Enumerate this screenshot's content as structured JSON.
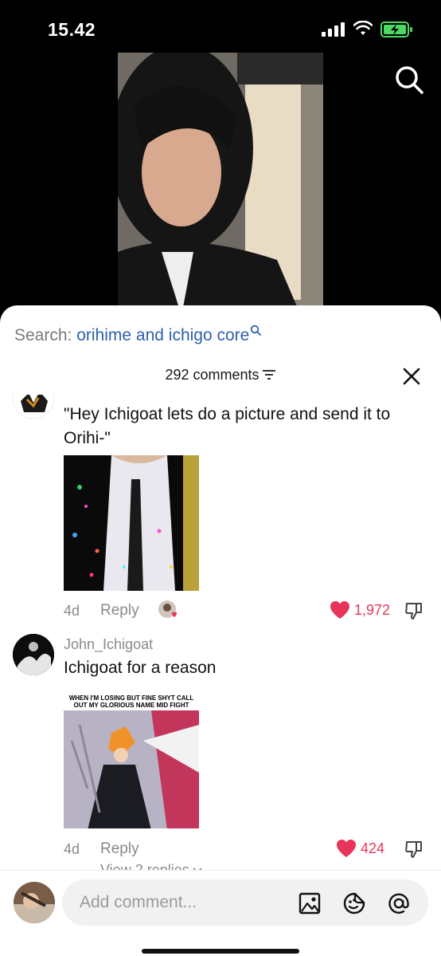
{
  "status_bar": {
    "time": "15.42"
  },
  "search_bar": {
    "prefix": "Search:",
    "query": "orihime and ichigo core"
  },
  "comments_header": {
    "count_label": "292 comments"
  },
  "comments": [
    {
      "text": "\"Hey Ichigoat lets do a picture and send it to Orihi-\"",
      "age": "4d",
      "reply_label": "Reply",
      "likes": "1,972",
      "liked": true
    },
    {
      "username": "John_Ichigoat",
      "text": "Ichigoat for a reason",
      "image_caption": "WHEN I'M LOSING BUT FINE SHYT CALL OUT MY GLORIOUS NAME MID FIGHT",
      "age": "4d",
      "reply_label": "Reply",
      "likes": "424",
      "liked": true,
      "view_replies": "View 2 replies"
    }
  ],
  "bottom_bar": {
    "input_placeholder": "Add comment..."
  },
  "icons": {
    "top": [
      "search-icon"
    ],
    "bar": [
      "image-icon",
      "sticker-icon",
      "mention-icon"
    ]
  },
  "colors": {
    "like": "#e8345a",
    "query": "#2f5fae",
    "battery": "#4cd964"
  }
}
